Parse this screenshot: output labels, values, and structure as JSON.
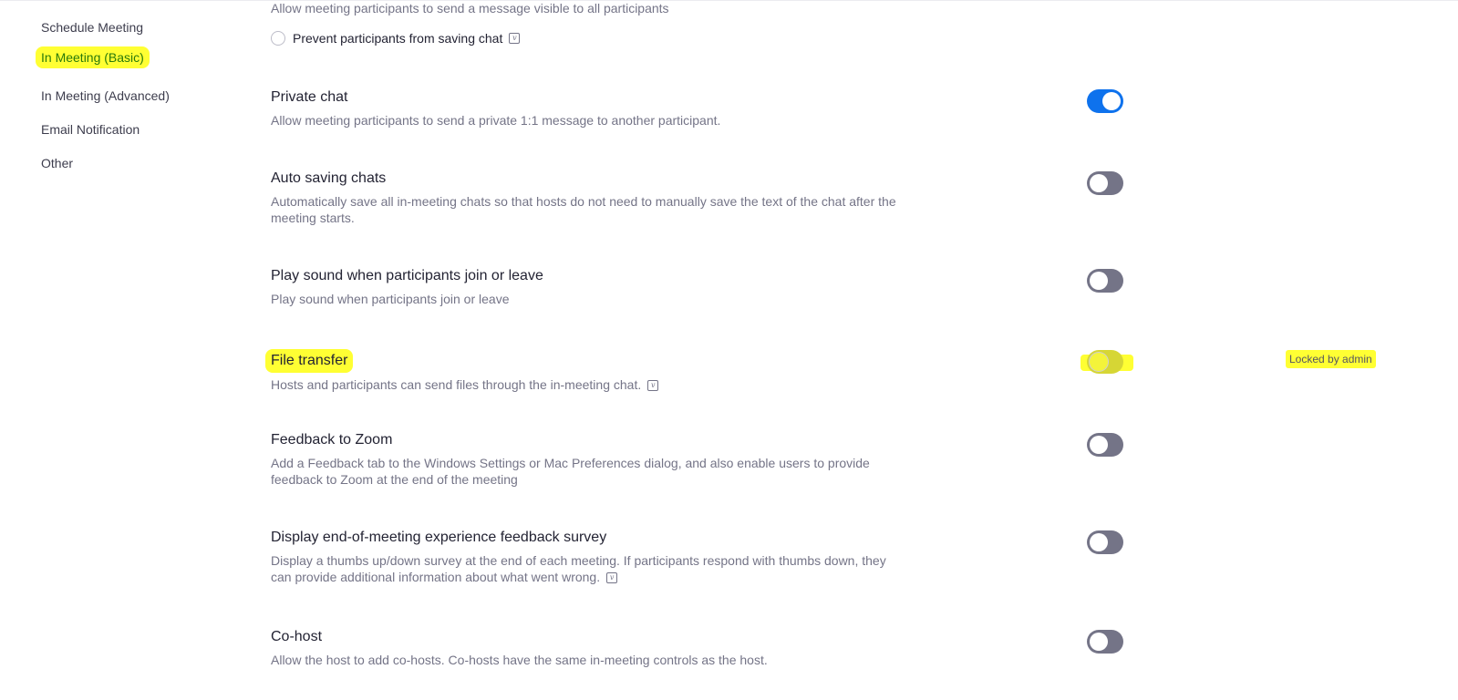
{
  "sidebar": {
    "items": [
      {
        "label": "Schedule Meeting",
        "active": false
      },
      {
        "label": "In Meeting (Basic)",
        "active": true
      },
      {
        "label": "In Meeting (Advanced)",
        "active": false
      },
      {
        "label": "Email Notification",
        "active": false
      },
      {
        "label": "Other",
        "active": false
      }
    ]
  },
  "chat": {
    "description": "Allow meeting participants to send a message visible to all participants",
    "prevent_saving_label": "Prevent participants from saving chat",
    "prevent_saving_checked": false,
    "info_icon": "v-info-icon"
  },
  "settings": [
    {
      "title": "Private chat",
      "description": "Allow meeting participants to send a private 1:1 message to another participant.",
      "enabled": true
    },
    {
      "title": "Auto saving chats",
      "description": "Automatically save all in-meeting chats so that hosts do not need to manually save the text of the chat after the meeting starts.",
      "enabled": false
    },
    {
      "title": "Play sound when participants join or leave",
      "description": "Play sound when participants join or leave",
      "enabled": false
    },
    {
      "title": "File transfer",
      "description": "Hosts and participants can send files through the in-meeting chat.",
      "enabled": false,
      "locked": true,
      "locked_label": "Locked by admin"
    },
    {
      "title": "Feedback to Zoom",
      "description": "Add a Feedback tab to the Windows Settings or Mac Preferences dialog, and also enable users to provide feedback to Zoom at the end of the meeting",
      "enabled": false
    },
    {
      "title": "Display end-of-meeting experience feedback survey",
      "description": "Display a thumbs up/down survey at the end of each meeting. If participants respond with thumbs down, they can provide additional information about what went wrong.",
      "enabled": false
    },
    {
      "title": "Co-host",
      "description": "Allow the host to add co-hosts. Co-hosts have the same in-meeting controls as the host.",
      "enabled": false
    }
  ],
  "colors": {
    "toggle_on": "#0e72ed",
    "toggle_off": "#747487",
    "highlight": "#ffff33"
  }
}
